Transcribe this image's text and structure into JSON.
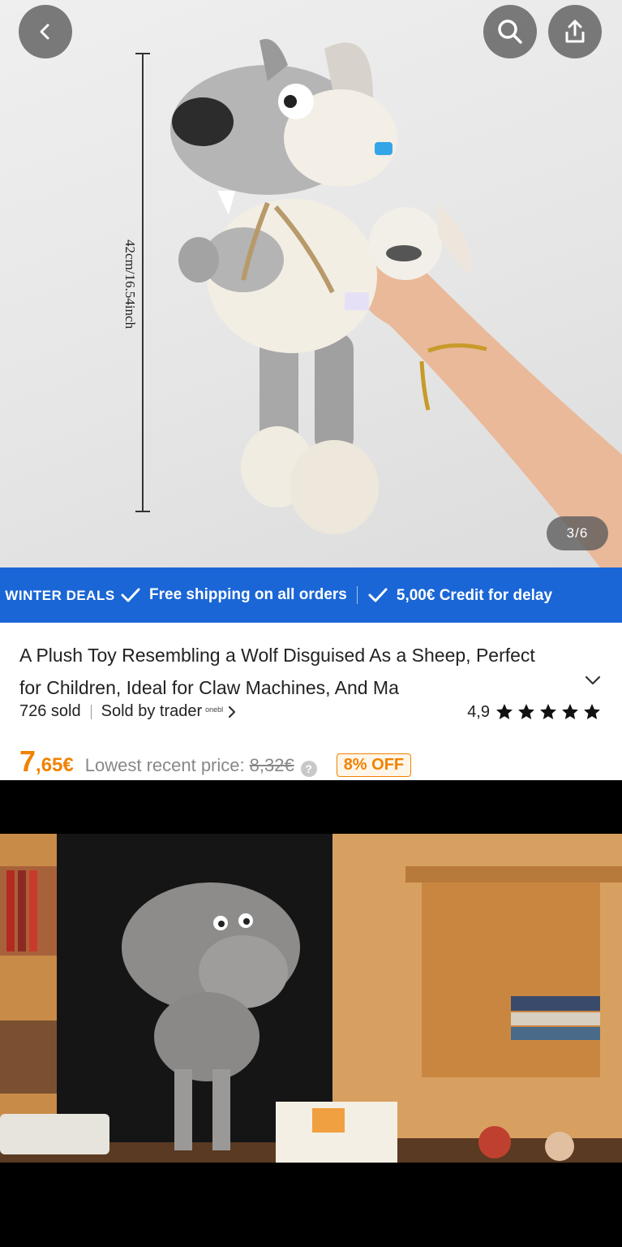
{
  "gallery": {
    "counter": "3/6",
    "size_label": "42cm/16.54inch"
  },
  "promo": {
    "title": "WINTER DEALS",
    "item1": "Free shipping on all orders",
    "item2": "5,00€ Credit for delay"
  },
  "product": {
    "title": "A Plush Toy Resembling a Wolf Disguised As a Sheep, Perfect for Children, Ideal for Claw Machines, And Ma",
    "sold": "726 sold",
    "sold_by": "Sold by trader",
    "trader_logo_text": "onebl",
    "rating": "4,9",
    "stars": 5,
    "price_main": "7",
    "price_cents": ",65€",
    "lowest_label": "Lowest recent price:",
    "old_price": "8,32€",
    "discount": "8% OFF"
  },
  "icons": {
    "back": "back-arrow-icon",
    "search": "search-icon",
    "share": "share-icon"
  },
  "colors": {
    "promo_blue": "#1a66d6",
    "price_orange": "#f18200"
  }
}
